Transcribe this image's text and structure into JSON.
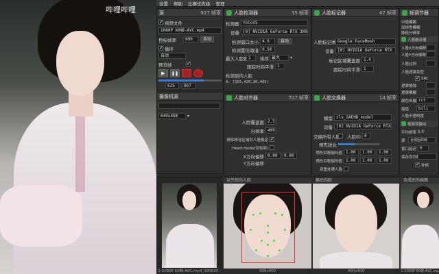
{
  "menu": {
    "settings": "设置",
    "help": "帮助",
    "restart": "比赛优先级",
    "advanced": "管理"
  },
  "watermark": "哔哩哔哩",
  "source_panel": {
    "title": "源",
    "fps": "927 帧率",
    "video_file_label": "视频文件",
    "file_name": "1080P 60帧-AVC.mp4",
    "fps_label": "目标帧率",
    "fps_value": "600",
    "auto_label": "自动",
    "loop_label": "循环",
    "preview_label": "预览帧",
    "frame_current": "625",
    "frame_total": "867"
  },
  "camera_panel": {
    "title": "摄像机源",
    "resolution": "640x480"
  },
  "detector_panel": {
    "title": "人脸检测器",
    "fps": "35 帧率",
    "detector_label": "检测器",
    "detector_value": "YoloV5",
    "device_label": "设备",
    "device_value": "[0] NVIDIA GeForce RTX 309€",
    "window_label": "检测窗口大小",
    "window_value": "4.6",
    "threshold_label": "检测置信阈值",
    "threshold_value": "0.50",
    "max_faces_label": "最大人脸数",
    "max_faces_value": "1",
    "sort_label": "排序",
    "sort_value": "最大",
    "temporal_label": "跟踪时间平滑",
    "temporal_value": "1",
    "detected_label": "检测到的人脸",
    "detected_value": "0: [155,420,30,405]"
  },
  "marker_panel": {
    "title": "人脸标记器",
    "fps": "47 帧率",
    "type_label": "人脸标记类型",
    "type_value": "Google FaceMesh",
    "device_label": "设备",
    "device_value": "[0] NVIDIA GeForce RTX",
    "coverage_label": "标记区域覆盖面",
    "coverage_value": "1.4",
    "temporal_label": "跟踪时间平滑",
    "temporal_value": "1"
  },
  "aligner_panel": {
    "title": "人脸对齐器",
    "fps": "707 帧率",
    "coverage_label": "人脸覆盖面",
    "coverage_value": "2.5",
    "resolution_label": "分辨率",
    "resolution_value": "400",
    "exclude_label": "排除移动区域对人脸稳定",
    "head_mode_label": "Head mode(仅有部)",
    "x_offset_label": "X方向偏移",
    "y_offset_label": "Y方向偏移",
    "x_value": "0.00",
    "y_value": "0.00"
  },
  "swapper_panel": {
    "title": "人脸交换器",
    "fps": "14 帧率",
    "model_label": "模型",
    "model_value": "zls_SAEHD_model",
    "device_label": "设备",
    "device_value": "[0] NVIDIA GeForce RTX",
    "swap_all_label": "交换所有人脸",
    "face_id_label": "人脸ID",
    "face_id_value": "0",
    "morph_label": "预先锐化",
    "pre_gamma_label": "预先匹配伽玛值",
    "pre_gamma_values": [
      "1.00",
      "1.00",
      "1.00"
    ],
    "post_gamma_label": "预先匹配伽玛值",
    "post_gamma_values": [
      "1.00",
      "1.00",
      "1.00"
    ],
    "two_pass_label": "双重处理人脸"
  },
  "merger_panel": {
    "title": "帧调节器",
    "items": [
      "中值模糊",
      "双线性模糊",
      "降低分辨率"
    ],
    "sub_title": "人脸融合器",
    "face_x_label": "人脸X方向偏移",
    "face_y_label": "人脸Y方向偏移",
    "face_scale_label": "人脸比例",
    "face_mask_label": "人脸遮罩类型",
    "src_label": "SRC",
    "erode_label": "遮罩侵蚀",
    "blur_label": "遮罩模糊",
    "color_label": "颜色传输",
    "color_value": "rct",
    "interp_label": "插值",
    "interp_value": "bili",
    "opacity_label": "人脸不透明度",
    "stream_title": "视频流输出",
    "avg_fps_label": "平均帧率",
    "avg_fps_value": "5.0",
    "source_label": "源",
    "source_value": "合成后的帧",
    "delay_label": "窗口延迟",
    "delay_value": "0",
    "save_label": "保存序列帧",
    "fill_label": "补帧"
  },
  "previews": {
    "source_frame": "1-1080P 60帧-AVC.mp4_000625 - 420x1066",
    "aligned_face_title": "对齐后的人脸",
    "aligned_face_size": "400x400",
    "swapped_face_title": "换后的脸",
    "swapped_face_size": "400x400",
    "merged_title": "合成后的画面",
    "merged_footer": "1-1080P 60帧-AVC.mp"
  }
}
